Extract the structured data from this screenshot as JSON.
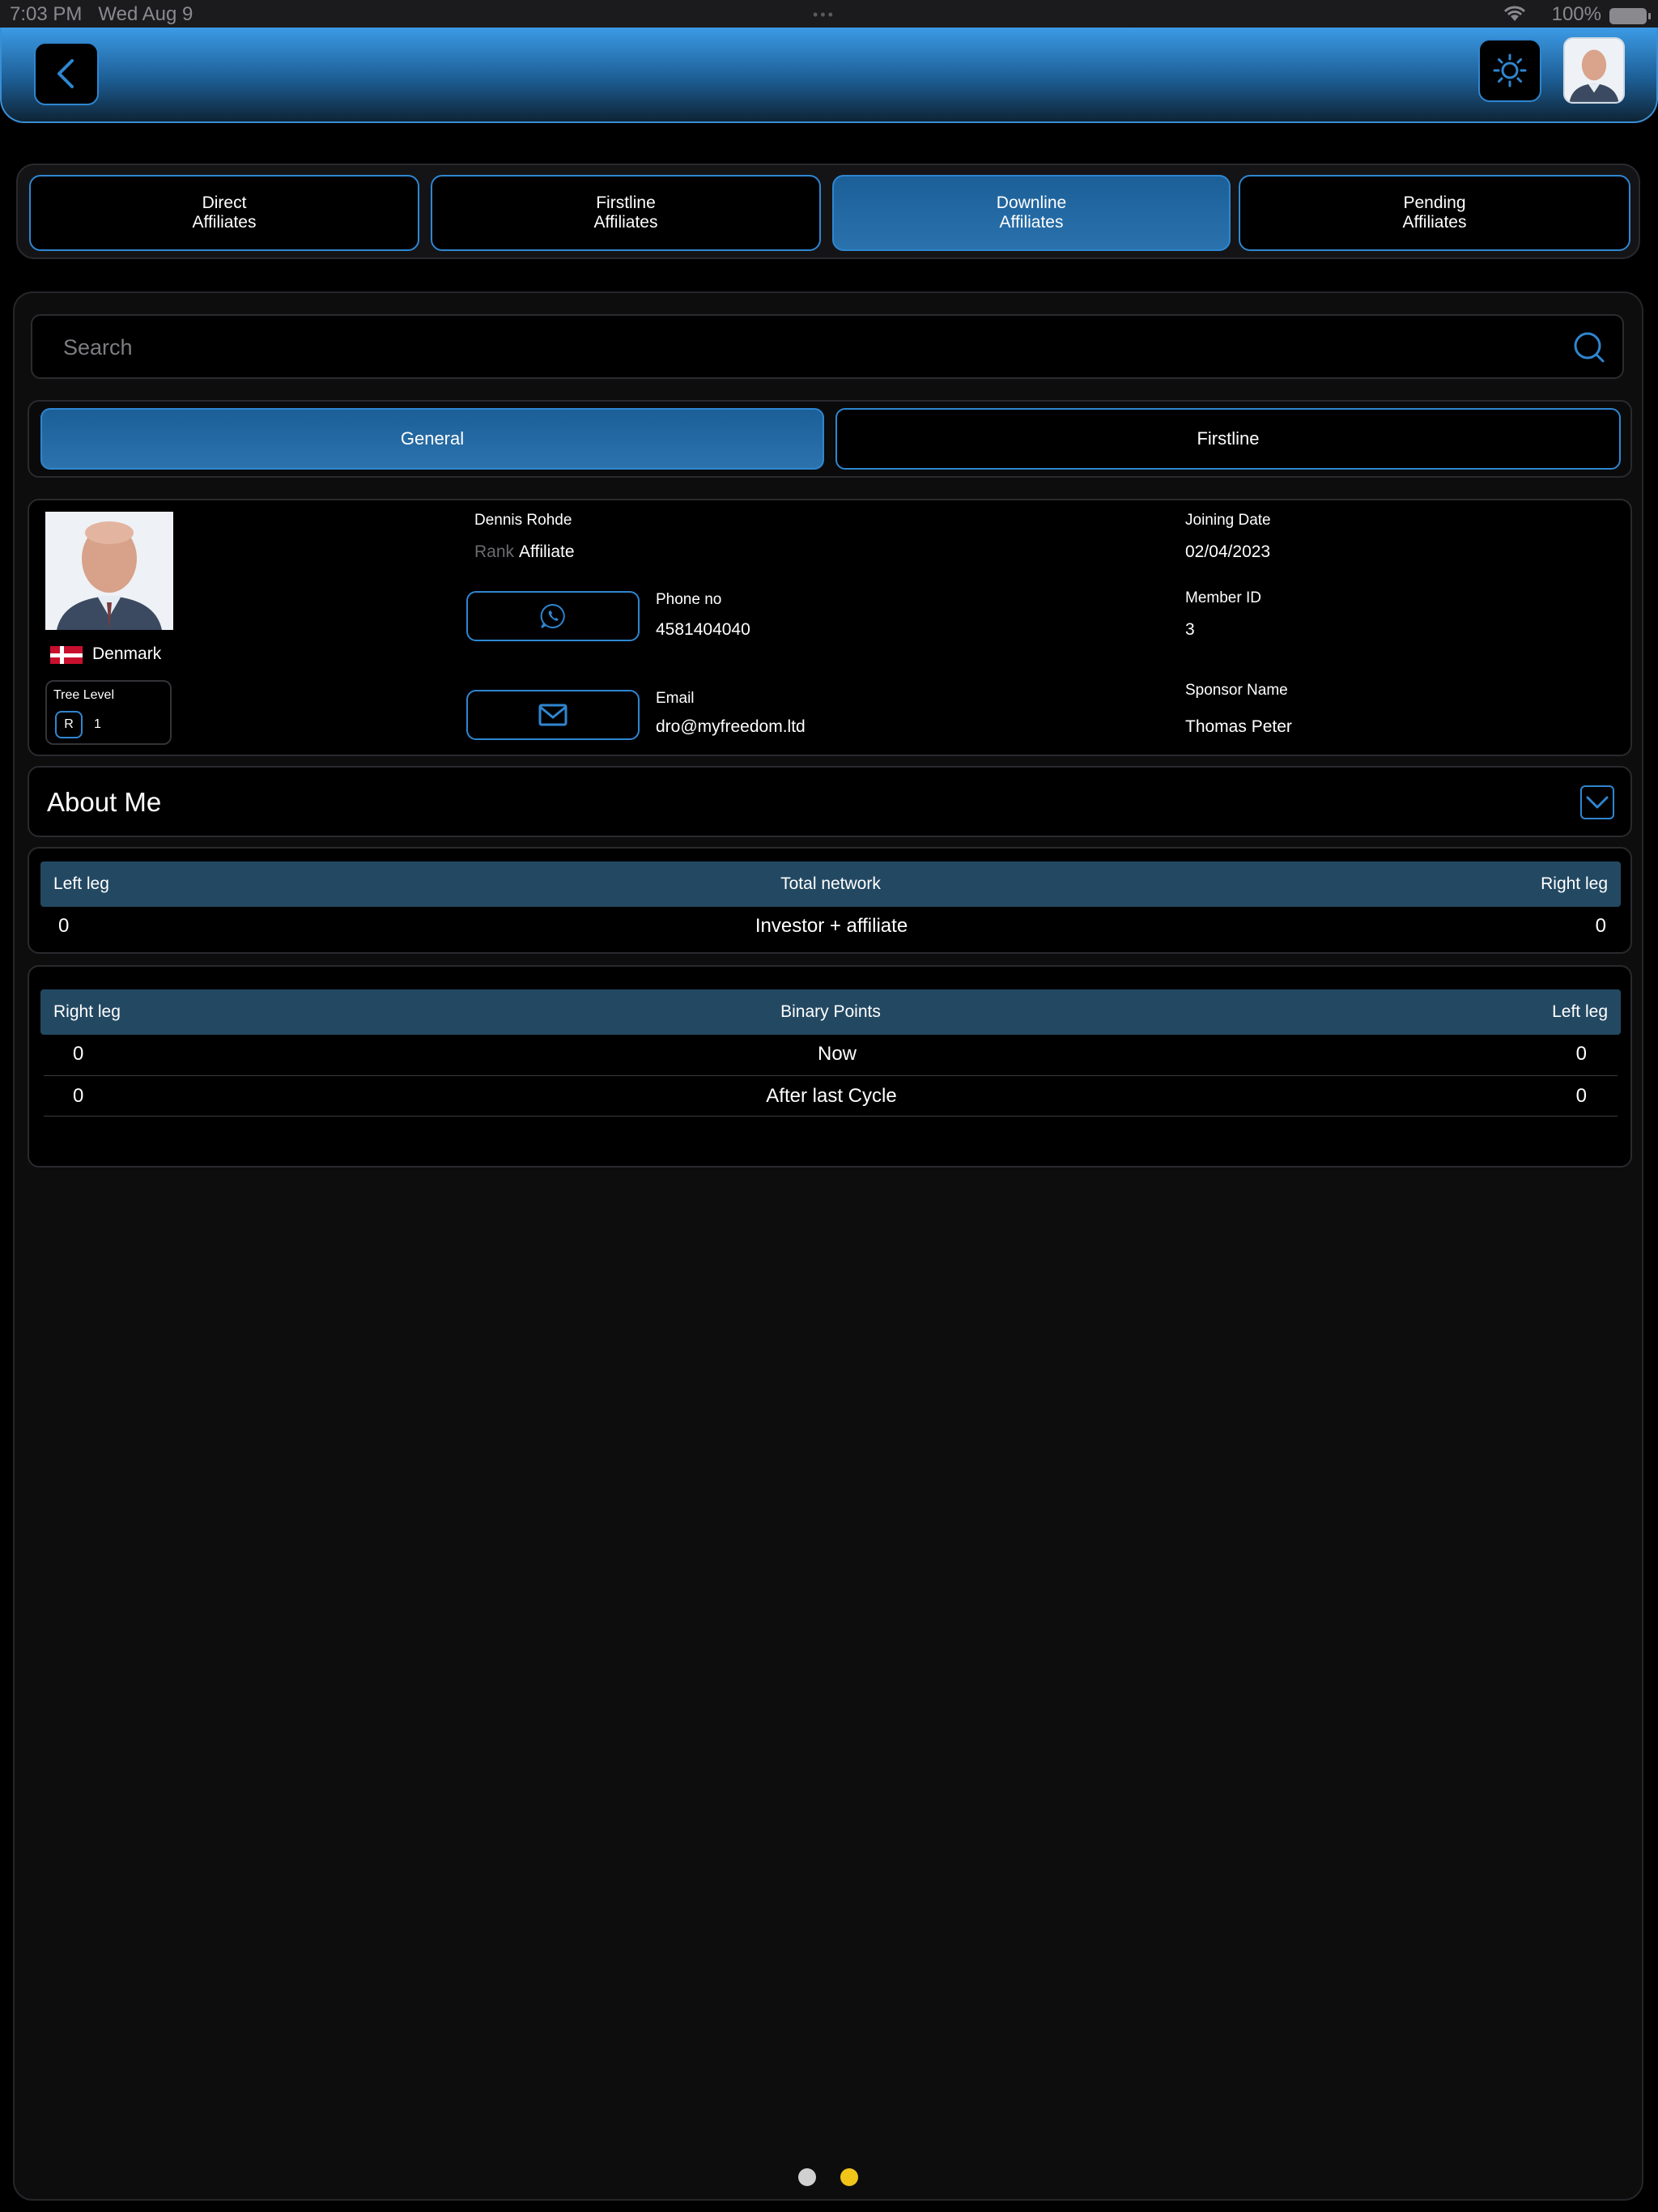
{
  "status_bar": {
    "time": "7:03 PM",
    "date": "Wed Aug 9",
    "battery": "100%"
  },
  "header": {
    "back_icon": "chevron-left-icon",
    "theme_icon": "sun-icon",
    "avatar_icon": "user-avatar"
  },
  "main_tabs": [
    {
      "label": "Direct\nAffiliates",
      "active": false
    },
    {
      "label": "Firstline\nAffiliates",
      "active": false
    },
    {
      "label": "Downline\nAffiliates",
      "active": true
    },
    {
      "label": "Pending\nAffiliates",
      "active": false
    }
  ],
  "search": {
    "placeholder": "Search",
    "value": ""
  },
  "sub_tabs": [
    {
      "label": "General",
      "active": true
    },
    {
      "label": "Firstline",
      "active": false
    }
  ],
  "profile": {
    "name": "Dennis Rohde",
    "rank_label": "Rank",
    "rank_value": "Affiliate",
    "country": "Denmark",
    "tree_level_label": "Tree Level",
    "tree_level_badge": "R",
    "tree_level_value": "1",
    "phone_label": "Phone no",
    "phone_value": "4581404040",
    "email_label": "Email",
    "email_value": "dro@myfreedom.ltd",
    "joining_label": "Joining Date",
    "joining_value": "02/04/2023",
    "member_label": "Member ID",
    "member_value": "3",
    "sponsor_label": "Sponsor Name",
    "sponsor_value": "Thomas Peter"
  },
  "about": {
    "title": "About Me"
  },
  "network_table": {
    "headers": [
      "Left leg",
      "Total network",
      "Right leg"
    ],
    "rows": [
      {
        "left": "0",
        "label": "Investor + affiliate",
        "right": "0"
      }
    ]
  },
  "binary_table": {
    "headers": [
      "Right leg",
      "Binary Points",
      "Left leg"
    ],
    "rows": [
      {
        "left": "0",
        "label": "Now",
        "right": "0"
      },
      {
        "left": "0",
        "label": "After last Cycle",
        "right": "0"
      }
    ]
  },
  "colors": {
    "accent": "#2f86d0",
    "header_top": "#3c9be6",
    "table_header": "#234862",
    "page_dot_active": "#f0c419",
    "page_dot_inactive": "#d0d0d0"
  },
  "pagination": {
    "count": 2,
    "active_index": 1
  }
}
